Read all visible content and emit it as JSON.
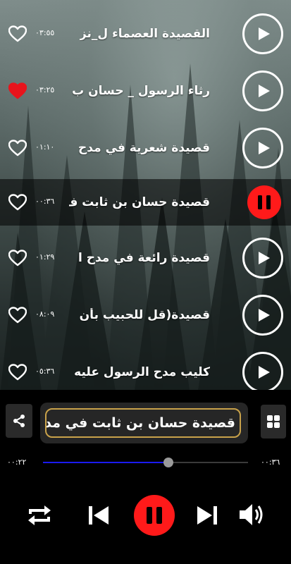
{
  "songs": [
    {
      "title": "القصيدة العصماء ل_نز",
      "duration": "٠٣:٥٥",
      "favorite": false,
      "state": "idle"
    },
    {
      "title": "رثاء الرسول _ حسان ب",
      "duration": "٠٣:٢٥",
      "favorite": true,
      "state": "idle"
    },
    {
      "title": "قصيدة  شعرية في مدح",
      "duration": "٠١:١٠",
      "favorite": false,
      "state": "idle"
    },
    {
      "title": "قصيدة حسان بن ثابت ف",
      "duration": "٠٠:٣٦",
      "favorite": false,
      "state": "playing"
    },
    {
      "title": "قصيدة رائعة في مدح ا",
      "duration": "٠١:٢٩",
      "favorite": false,
      "state": "idle"
    },
    {
      "title": "قصيدة(قل للحبيب بأن",
      "duration": "٠٨:٠٩",
      "favorite": false,
      "state": "idle"
    },
    {
      "title": "كليب مدح الرسول عليه",
      "duration": "٠٥:٣٦",
      "favorite": false,
      "state": "idle"
    }
  ],
  "player": {
    "now_playing": "قصيدة حسان بن ثابت في مدح",
    "elapsed": "٠٠:٢٢",
    "total": "٠٠:٣٦",
    "progress": 0.61
  },
  "colors": {
    "accent": "#ff1a1a",
    "seek": "#1a1aff",
    "favorite": "#e8141c",
    "border_gold": "#c9a24a"
  },
  "icons": {
    "share": "share-icon",
    "grid": "grid-icon",
    "repeat": "repeat-icon",
    "previous": "skip-previous-icon",
    "pause": "pause-icon",
    "next": "skip-next-icon",
    "volume": "volume-icon",
    "play": "play-icon",
    "heart": "heart-icon"
  }
}
